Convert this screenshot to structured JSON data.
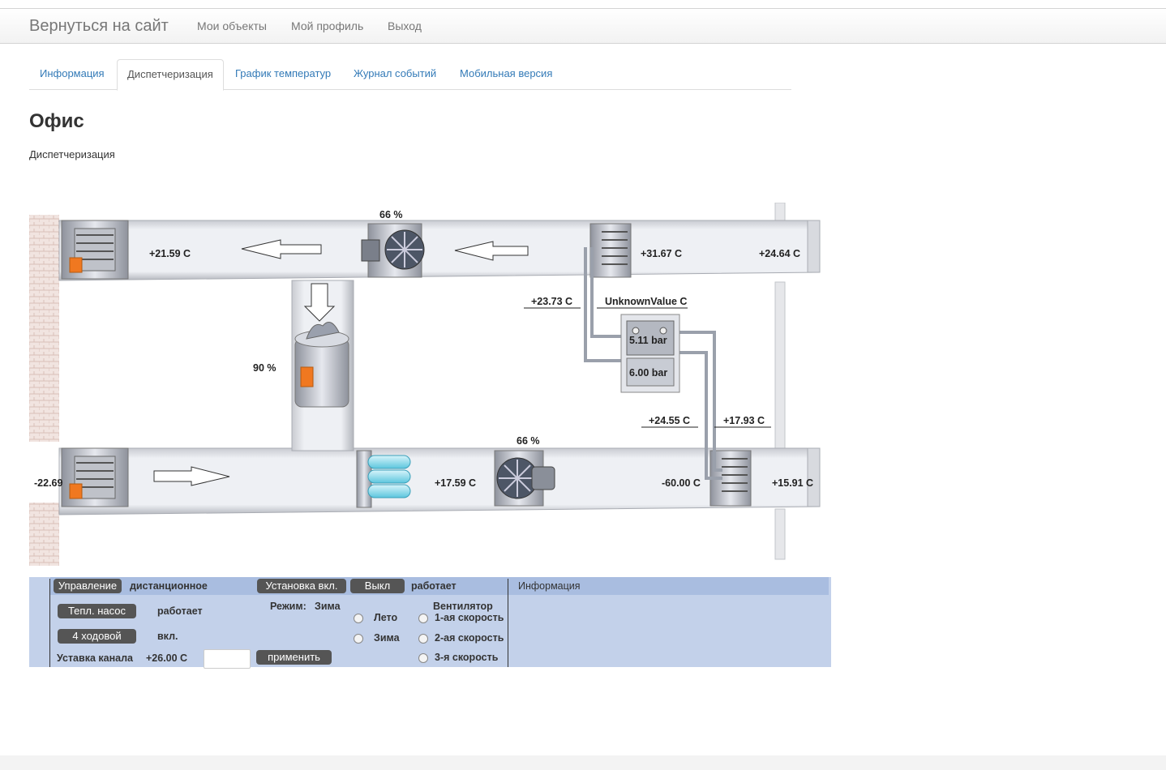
{
  "navbar": {
    "brand": "Вернуться на сайт",
    "links": [
      "Мои объекты",
      "Мой профиль",
      "Выход"
    ]
  },
  "tabs": [
    "Информация",
    "Диспетчеризация",
    "График температур",
    "Журнал событий",
    "Мобильная версия"
  ],
  "active_tab": "Диспетчеризация",
  "page": {
    "title": "Офис",
    "subtitle": "Диспетчеризация"
  },
  "scheme": {
    "supply_fan_percent": "66 %",
    "exhaust_fan_percent": "66 %",
    "recirc_damper_percent": "90 %",
    "temp_supply_out": "+21.59 C",
    "temp_exhaust_after_hx": "+31.67 C",
    "temp_exhaust_in": "+24.64 C",
    "temp_pipe_1": "+23.73 C",
    "temp_unknown": "UnknownValue C",
    "pressure_1": "5.11 bar",
    "pressure_2": "6.00 bar",
    "temp_pipe_2": "+24.55 C",
    "temp_pipe_3": "+17.93 C",
    "temp_outdoor": "-22.69",
    "temp_after_filter": "+17.59 C",
    "temp_hx_in": "-60.00 C",
    "temp_hx_out": "+15.91 C"
  },
  "panel": {
    "control_label": "Управление",
    "control_value": "дистанционное",
    "install_on_label": "Установка вкл.",
    "off_label": "Выкл",
    "unit_status": "работает",
    "info_label": "Информация",
    "heat_pump_label": "Тепл. насос",
    "heat_pump_status": "работает",
    "valve_label": "4 ходовой",
    "valve_status": "вкл.",
    "mode_label": "Режим:",
    "mode_value": "Зима",
    "mode_options": [
      "Лето",
      "Зима"
    ],
    "fan_label": "Вентилятор",
    "fan_speeds": [
      "1-ая скорость",
      "2-ая скорость",
      "3-я скорость"
    ],
    "channel_setpoint_label": "Уставка канала",
    "channel_setpoint_value": "+26.00 C",
    "setpoint_input_value": "",
    "apply_label": "применить"
  }
}
